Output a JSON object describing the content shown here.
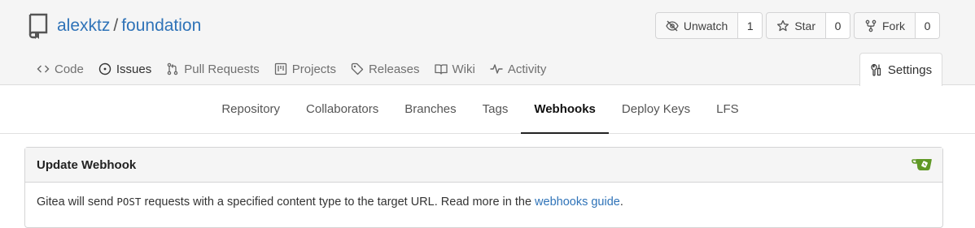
{
  "repo": {
    "owner": "alexktz",
    "separator": "/",
    "name": "foundation"
  },
  "actions": {
    "unwatch": {
      "label": "Unwatch",
      "count": "1",
      "icon": "eye-slash-icon"
    },
    "star": {
      "label": "Star",
      "count": "0",
      "icon": "star-icon"
    },
    "fork": {
      "label": "Fork",
      "count": "0",
      "icon": "fork-icon"
    }
  },
  "tabs": [
    {
      "label": "Code",
      "icon": "code-icon"
    },
    {
      "label": "Issues",
      "icon": "issue-icon"
    },
    {
      "label": "Pull Requests",
      "icon": "pull-request-icon"
    },
    {
      "label": "Projects",
      "icon": "project-icon"
    },
    {
      "label": "Releases",
      "icon": "tag-icon"
    },
    {
      "label": "Wiki",
      "icon": "book-icon"
    },
    {
      "label": "Activity",
      "icon": "pulse-icon"
    }
  ],
  "settings_tab": {
    "label": "Settings",
    "icon": "tools-icon"
  },
  "subnav": [
    {
      "label": "Repository"
    },
    {
      "label": "Collaborators"
    },
    {
      "label": "Branches"
    },
    {
      "label": "Tags"
    },
    {
      "label": "Webhooks",
      "active": true
    },
    {
      "label": "Deploy Keys"
    },
    {
      "label": "LFS"
    }
  ],
  "panel": {
    "title": "Update Webhook",
    "logo": "gitea-logo-icon",
    "desc_before": "Gitea will send ",
    "desc_code": "POST",
    "desc_after": " requests with a specified content type to the target URL. Read more in the ",
    "desc_link": "webhooks guide",
    "desc_end": "."
  },
  "colors": {
    "link": "#2f73b8",
    "gitea_green": "#609926"
  }
}
